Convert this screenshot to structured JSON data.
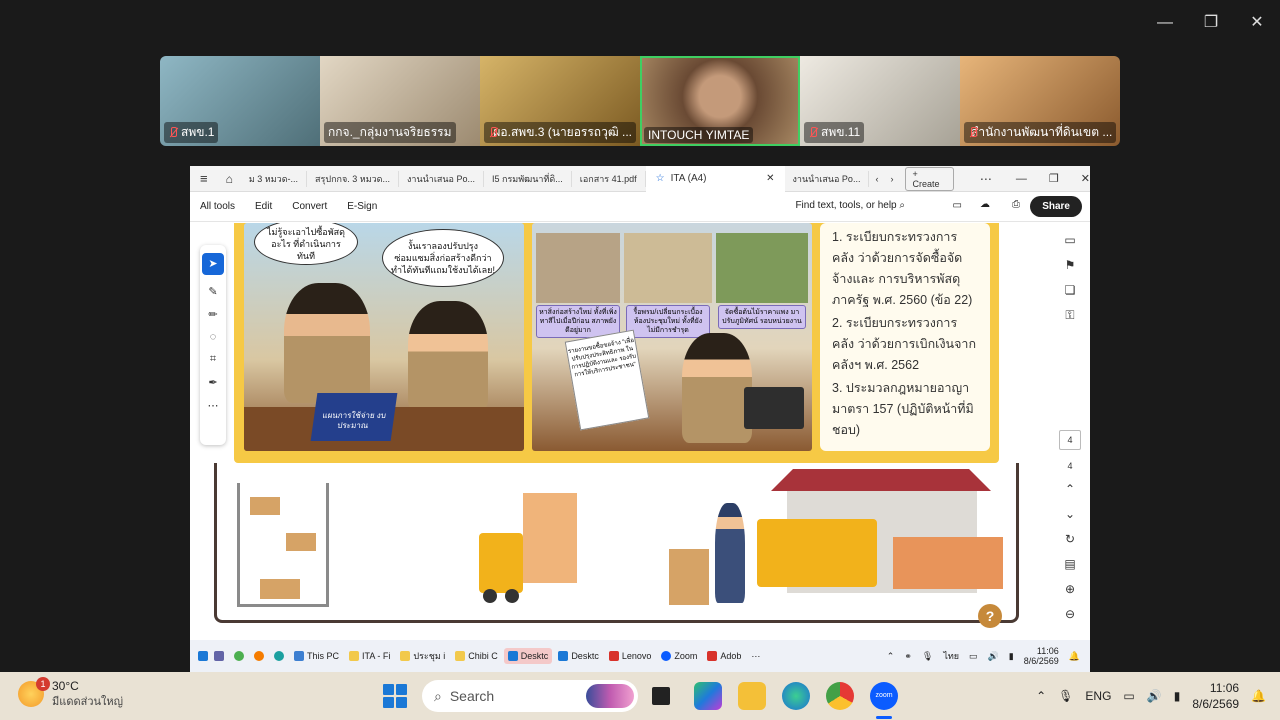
{
  "window_controls": {
    "minimize": "—",
    "restore": "❐",
    "close": "✕"
  },
  "participants": [
    {
      "name": "สพข.1",
      "muted": true,
      "bg": "#7aa6b4"
    },
    {
      "name": "กกจ._กลุ่มงานจริยธรรม",
      "muted": false,
      "bg": "#c7b9a2"
    },
    {
      "name": "ผอ.สพข.3 (นายอรรถวุฒิ ...",
      "muted": true,
      "bg": "#b48a3e"
    },
    {
      "name": "INTOUCH YIMTAE",
      "muted": false,
      "bg": "#8c6a4a",
      "active": true
    },
    {
      "name": "สพข.11",
      "muted": true,
      "bg": "#d8d4cc"
    },
    {
      "name": "สำนักงานพัฒนาที่ดินเขต ...",
      "muted": true,
      "bg": "#c38b4f"
    }
  ],
  "browser": {
    "tabs": [
      "ม 3 หมวด-...",
      "สรุปกกจ. 3 หมวด...",
      "งานนำเสนอ Po...",
      "I5 กรมพัฒนาที่ดิ...",
      "เอกสาร 41.pdf",
      "ITA (A4)",
      "งานนำเสนอ Po..."
    ],
    "active_tab": "ITA (A4)",
    "create_label": "Create",
    "menu": [
      "All tools",
      "Edit",
      "Convert",
      "E-Sign"
    ],
    "find_placeholder": "Find text, tools, or help",
    "share_label": "Share"
  },
  "document": {
    "bubble1": "ไม่รู้จะเอาไปซื้อพัสดุอะไร ที่ดำเนินการทันที",
    "bubble2": "งั้นเราลองปรับปรุง ซ่อมแซมสิ่งก่อสร้างดีกว่า ทำได้ทันทีแถมใช้งบได้เลย!",
    "tag1": "หาสิ่งก่อสร้างใหม่ ทั้งที่เพิ่งทาสีไปเมื่อปีก่อน สภาพยังดีอยู่มาก",
    "tag2": "รื้อพรม/เปลี่ยนกระเบื้อง ห้องประชุมใหม่ ทั้งที่ยัง ไม่มีการชำรุด",
    "tag3": "จัดซื้อต้นไม้ราคาแพง มาปรับภูมิทัศน์ รอบหน่วยงาน",
    "binder": "แผนการใช้จ่าย งบประมาณ",
    "sheet": "รายงานขอซื้อขอจ้าง \"เพื่อปรับปรุงประสิทธิภาพ ในการปฏิบัติงานและ รองรับการให้บริการประชาชน\"",
    "laws": [
      "1. ระเบียบกระทรวงการคลัง ว่าด้วยการจัดซื้อจัดจ้างและ การบริหารพัสดุภาครัฐ พ.ศ. 2560 (ข้อ 22)",
      "2. ระเบียบกระทรวงการคลัง ว่าด้วยการเบิกเงินจากคลังฯ พ.ศ. 2562",
      "3. ประมวลกฎหมายอาญา มาตรา 157 (ปฏิบัติหน้าที่มิ ชอบ)"
    ],
    "page_current": "4",
    "page_total": "4"
  },
  "remote_taskbar": {
    "apps": [
      "This PC",
      "ITA - Fi",
      "ประชุม i",
      "Chibi C",
      "Desktc",
      "Desktc",
      "Lenovo",
      "Zoom",
      "Adob"
    ],
    "active_app": "Desktc",
    "lang": "ไทย",
    "time": "11:06",
    "date": "8/6/2569"
  },
  "weather": {
    "temp": "30°C",
    "desc": "มีแดดส่วนใหญ่",
    "badge": "1"
  },
  "search_label": "Search",
  "tray": {
    "lang": "ENG",
    "time": "11:06",
    "date": "8/6/2569"
  },
  "colors": {
    "accent": "#1a78d6",
    "panel_yellow": "#f6c945",
    "zoom_blue": "#0b5cff"
  }
}
